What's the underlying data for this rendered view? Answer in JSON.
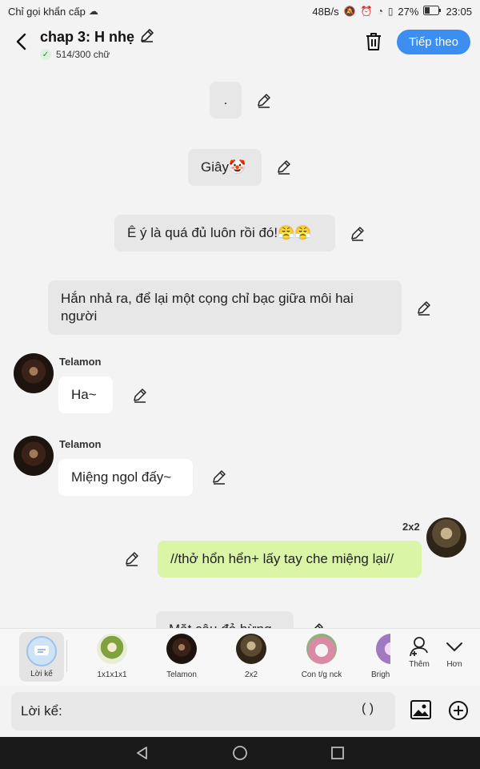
{
  "status_bar": {
    "carrier": "Chỉ gọi khẩn cấp",
    "network_speed": "48B/s",
    "battery": "27%",
    "time": "23:05"
  },
  "header": {
    "title": "chap 3: H nhẹ",
    "word_count": "514/300 chữ",
    "next_label": "Tiếp theo"
  },
  "messages": {
    "narr1": ".",
    "narr2": "Giây🤡",
    "narr3": "Ê ý là quá đủ luôn rồi đó!😤😤",
    "narr4": "Hắn nhả ra, để lại một cọng chỉ bạc giữa môi hai người",
    "msg1_sender": "Telamon",
    "msg1_text": "Ha~",
    "msg2_sender": "Telamon",
    "msg2_text": "Miệng ngol đấy~",
    "msg3_sender": "2x2",
    "msg3_text": "//thở hổn hển+ lấy tay che miệng lại//",
    "narr5_partial": "Mặt cậu đỏ bừng"
  },
  "characters": {
    "narrator": "Lời kể",
    "c1": "1x1x1x1",
    "c2": "Telamon",
    "c3": "2x2",
    "c4": "Con t/g nck",
    "c5": "Brigh",
    "add": "Thêm",
    "more": "Hơn"
  },
  "input": {
    "label": "Lời kể:",
    "paren": "( )"
  },
  "colors": {
    "accent": "#3d8ef1",
    "user_bubble": "#d9f5a5",
    "narration_bg": "#e7e7e7"
  }
}
